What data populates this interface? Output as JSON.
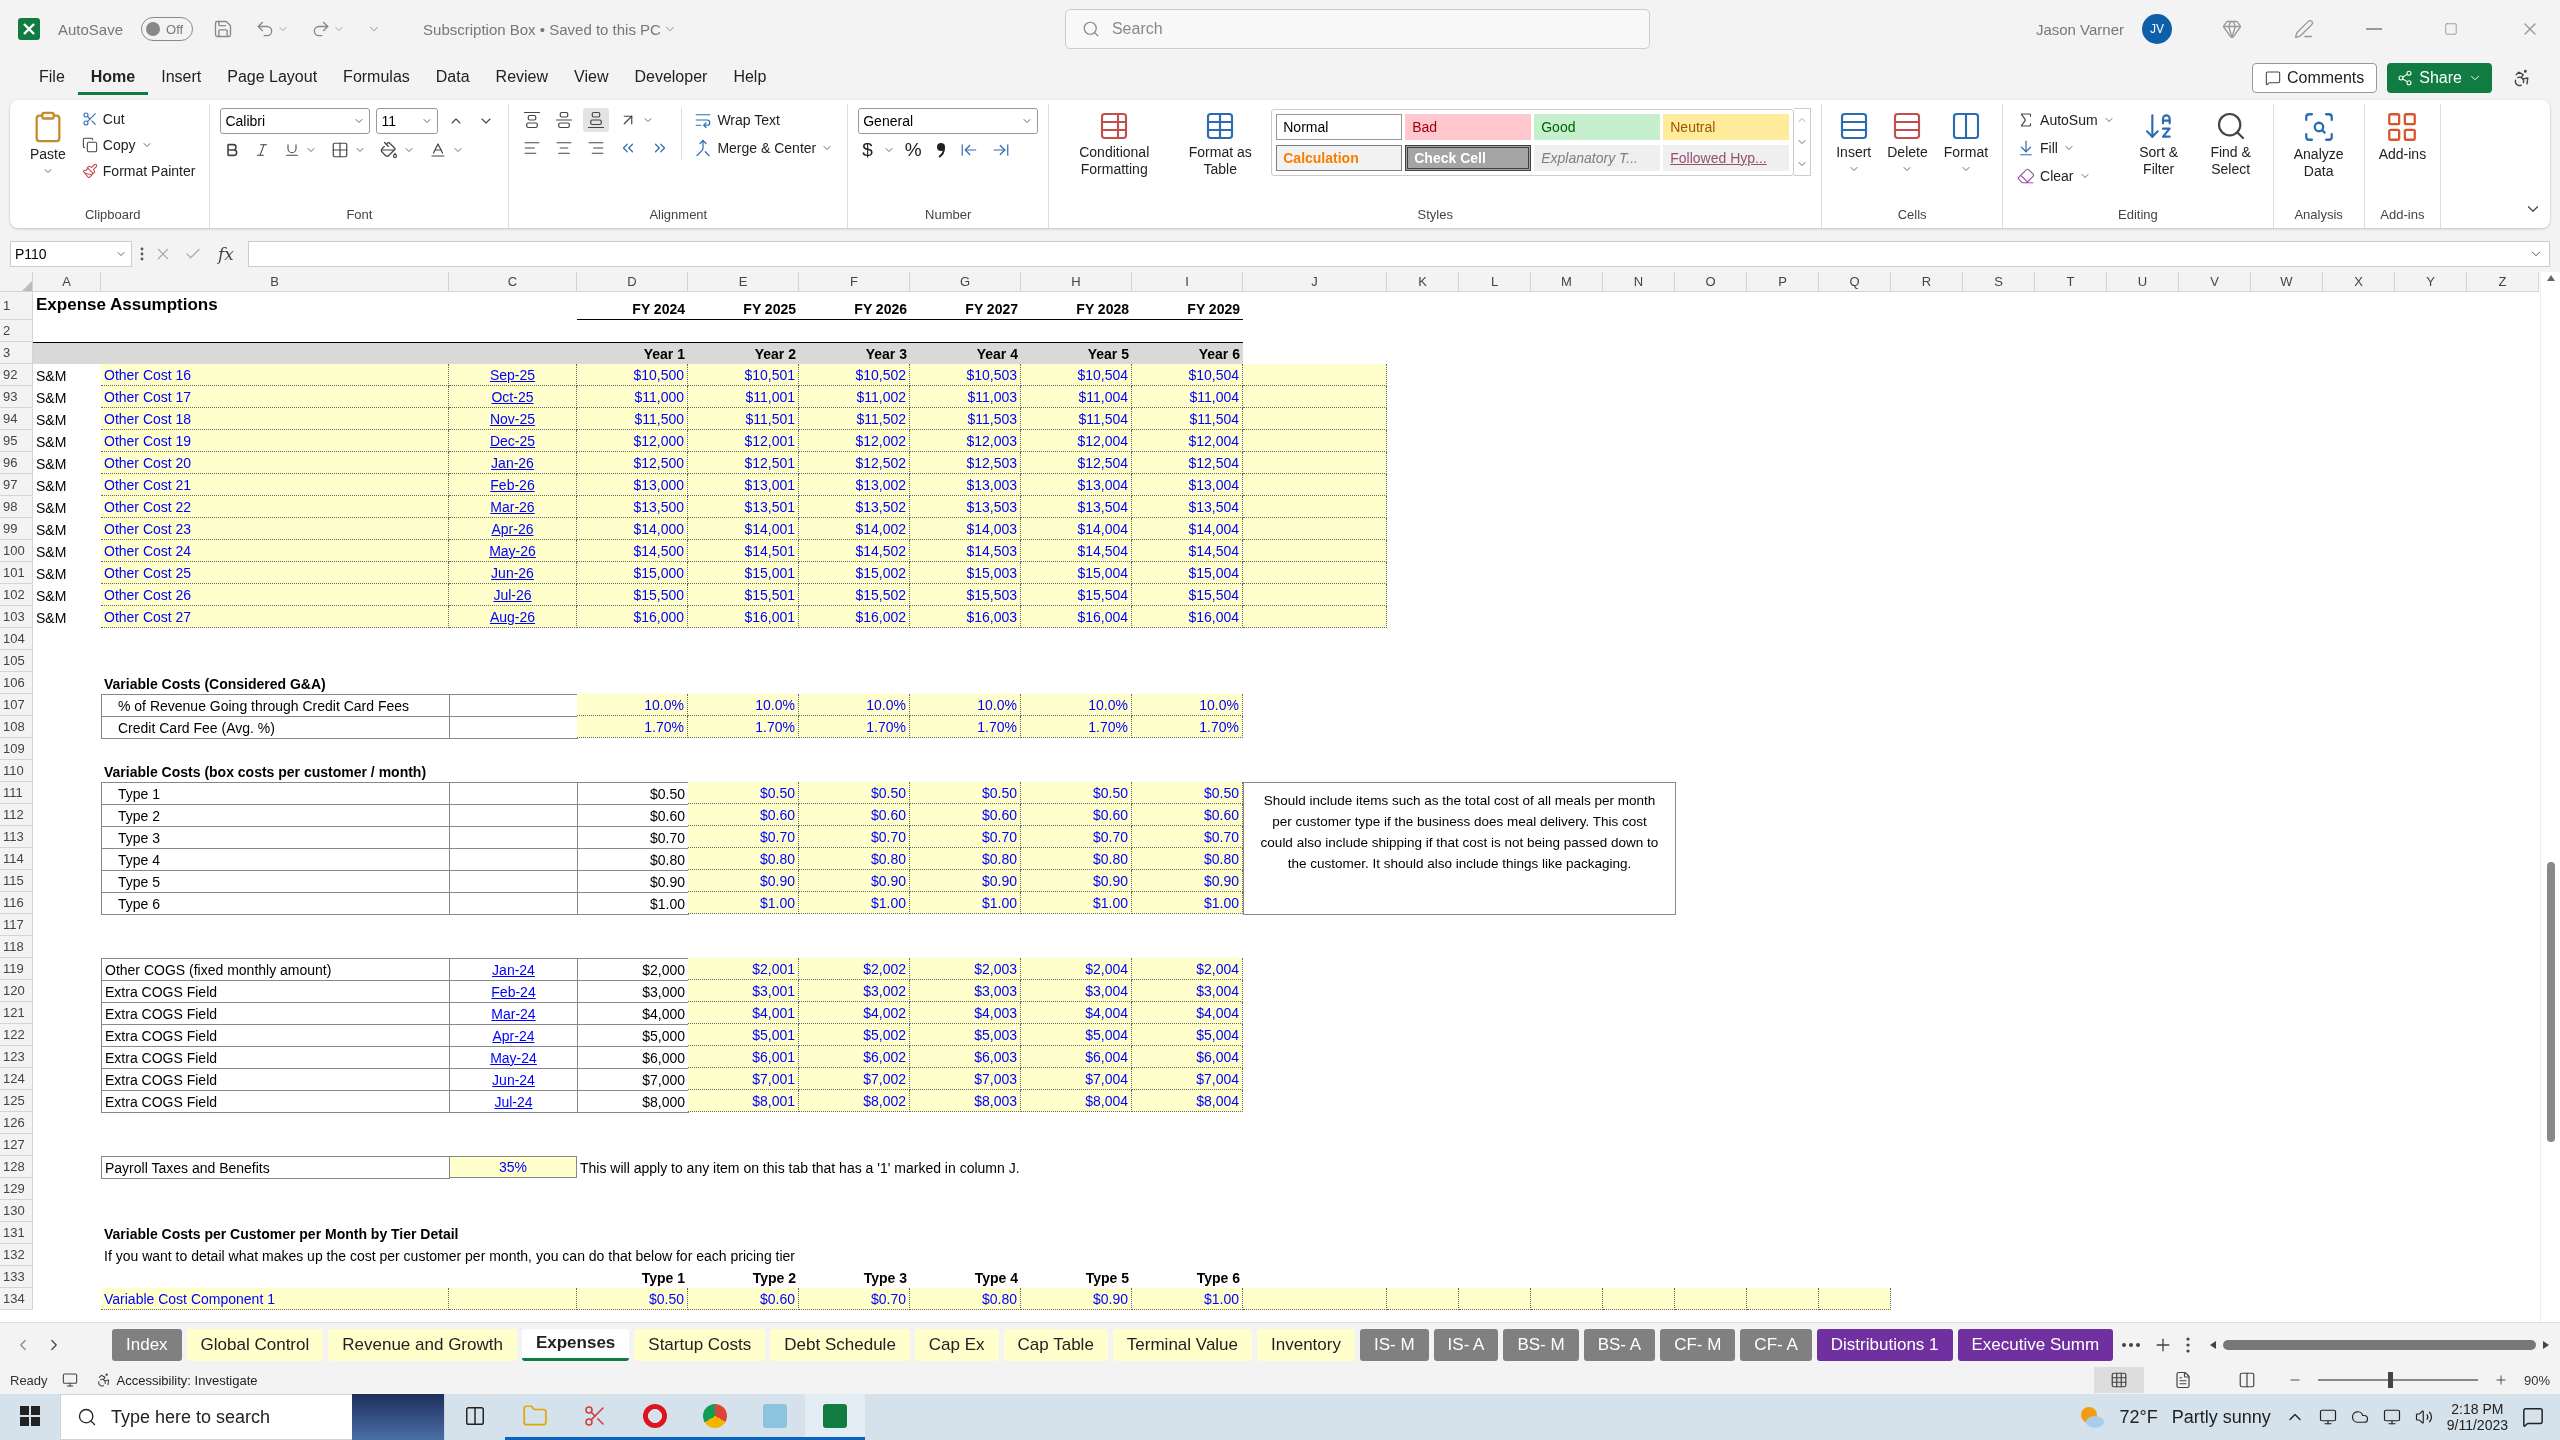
{
  "title_bar": {
    "autosave_label": "AutoSave",
    "autosave": {
      "on": false,
      "label": "Off"
    },
    "document": "Subscription Box • Saved to this PC",
    "search_placeholder": "Search",
    "user": "Jason Varner",
    "avatar": "JV"
  },
  "menu": {
    "tabs": [
      {
        "label": "File",
        "selected": false
      },
      {
        "label": "Home",
        "selected": true
      },
      {
        "label": "Insert",
        "selected": false
      },
      {
        "label": "Page Layout",
        "selected": false
      },
      {
        "label": "Formulas",
        "selected": false
      },
      {
        "label": "Data",
        "selected": false
      },
      {
        "label": "Review",
        "selected": false
      },
      {
        "label": "View",
        "selected": false
      },
      {
        "label": "Developer",
        "selected": false
      },
      {
        "label": "Help",
        "selected": false
      }
    ],
    "comments": "Comments",
    "share": "Share"
  },
  "ribbon": {
    "clipboard": {
      "label": "Clipboard",
      "paste": "Paste",
      "cut": "Cut",
      "copy": "Copy",
      "format_painter": "Format Painter"
    },
    "font": {
      "label": "Font",
      "name": "Calibri",
      "size": "11"
    },
    "alignment": {
      "label": "Alignment",
      "wrap": "Wrap Text",
      "merge": "Merge & Center"
    },
    "number": {
      "label": "Number",
      "format": "General",
      "currency": "$",
      "percent": "%"
    },
    "styles": {
      "label": "Styles",
      "conditional": "Conditional Formatting",
      "format_table": "Format as Table",
      "items": [
        {
          "label": "Normal",
          "kind": "normal"
        },
        {
          "label": "Bad",
          "kind": "bad"
        },
        {
          "label": "Good",
          "kind": "good"
        },
        {
          "label": "Neutral",
          "kind": "neutral"
        },
        {
          "label": "Calculation",
          "kind": "calculation"
        },
        {
          "label": "Check Cell",
          "kind": "check"
        },
        {
          "label": "Explanatory T...",
          "kind": "explanatory"
        },
        {
          "label": "Followed Hyp...",
          "kind": "followed"
        }
      ]
    },
    "cells": {
      "label": "Cells",
      "insert": "Insert",
      "delete": "Delete",
      "format": "Format"
    },
    "editing": {
      "label": "Editing",
      "autosum": "AutoSum",
      "fill": "Fill",
      "clear": "Clear",
      "sort": "Sort & Filter",
      "find": "Find & Select"
    },
    "analysis": {
      "label": "Analysis",
      "analyze": "Analyze Data"
    },
    "addins": {
      "label": "Add-ins",
      "addins": "Add-ins"
    }
  },
  "formula_bar": {
    "name_box": "P110",
    "fx": "fx"
  },
  "sheet": {
    "columns": [
      "A",
      "B",
      "C",
      "D",
      "E",
      "F",
      "G",
      "H",
      "I",
      "J",
      "K",
      "L",
      "M",
      "N",
      "O",
      "P",
      "Q",
      "R",
      "S",
      "T",
      "U",
      "V",
      "W",
      "X",
      "Y",
      "Z"
    ],
    "rows": [
      {
        "number": "1",
        "cells": [
          {
            "text": "Expense Assumptions",
            "kind": "title"
          },
          {
            "kind": "blank"
          },
          {
            "kind": "blank"
          },
          {
            "text": "FY 2024",
            "kind": "fy"
          },
          {
            "text": "FY 2025",
            "kind": "fy"
          },
          {
            "text": "FY 2026",
            "kind": "fy"
          },
          {
            "text": "FY 2027",
            "kind": "fy"
          },
          {
            "text": "FY 2028",
            "kind": "fy"
          },
          {
            "text": "FY 2029",
            "kind": "fy"
          }
        ]
      },
      {
        "number": "2",
        "cells": []
      },
      {
        "number": "3",
        "cells": [
          {
            "kind": "band"
          },
          {
            "kind": "band"
          },
          {
            "kind": "band"
          },
          {
            "text": "Year 1",
            "kind": "band"
          },
          {
            "text": "Year 2",
            "kind": "band"
          },
          {
            "text": "Year 3",
            "kind": "band"
          },
          {
            "text": "Year 4",
            "kind": "band"
          },
          {
            "text": "Year 5",
            "kind": "band"
          },
          {
            "text": "Year 6",
            "kind": "band"
          }
        ]
      },
      {
        "number": "92",
        "cells": [
          {
            "text": "S&M",
            "kind": "text"
          },
          {
            "text": "Other Cost 16",
            "kind": "input-label"
          },
          {
            "text": "Sep-25",
            "kind": "input-link"
          },
          {
            "text": "$10,500",
            "kind": "input"
          },
          {
            "text": "$10,501",
            "kind": "input"
          },
          {
            "text": "$10,502",
            "kind": "input"
          },
          {
            "text": "$10,503",
            "kind": "input"
          },
          {
            "text": "$10,504",
            "kind": "input"
          },
          {
            "text": "$10,504",
            "kind": "input"
          },
          {
            "kind": "input"
          }
        ]
      },
      {
        "number": "93",
        "cells": [
          {
            "text": "S&M",
            "kind": "text"
          },
          {
            "text": "Other Cost 17",
            "kind": "input-label"
          },
          {
            "text": "Oct-25",
            "kind": "input-link"
          },
          {
            "text": "$11,000",
            "kind": "input"
          },
          {
            "text": "$11,001",
            "kind": "input"
          },
          {
            "text": "$11,002",
            "kind": "input"
          },
          {
            "text": "$11,003",
            "kind": "input"
          },
          {
            "text": "$11,004",
            "kind": "input"
          },
          {
            "text": "$11,004",
            "kind": "input"
          },
          {
            "kind": "input"
          }
        ]
      },
      {
        "number": "94",
        "cells": [
          {
            "text": "S&M",
            "kind": "text"
          },
          {
            "text": "Other Cost 18",
            "kind": "input-label"
          },
          {
            "text": "Nov-25",
            "kind": "input-link"
          },
          {
            "text": "$11,500",
            "kind": "input"
          },
          {
            "text": "$11,501",
            "kind": "input"
          },
          {
            "text": "$11,502",
            "kind": "input"
          },
          {
            "text": "$11,503",
            "kind": "input"
          },
          {
            "text": "$11,504",
            "kind": "input"
          },
          {
            "text": "$11,504",
            "kind": "input"
          },
          {
            "kind": "input"
          }
        ]
      },
      {
        "number": "95",
        "cells": [
          {
            "text": "S&M",
            "kind": "text"
          },
          {
            "text": "Other Cost 19",
            "kind": "input-label"
          },
          {
            "text": "Dec-25",
            "kind": "input-link"
          },
          {
            "text": "$12,000",
            "kind": "input"
          },
          {
            "text": "$12,001",
            "kind": "input"
          },
          {
            "text": "$12,002",
            "kind": "input"
          },
          {
            "text": "$12,003",
            "kind": "input"
          },
          {
            "text": "$12,004",
            "kind": "input"
          },
          {
            "text": "$12,004",
            "kind": "input"
          },
          {
            "kind": "input"
          }
        ]
      },
      {
        "number": "96",
        "cells": [
          {
            "text": "S&M",
            "kind": "text"
          },
          {
            "text": "Other Cost 20",
            "kind": "input-label"
          },
          {
            "text": "Jan-26",
            "kind": "input-link"
          },
          {
            "text": "$12,500",
            "kind": "input"
          },
          {
            "text": "$12,501",
            "kind": "input"
          },
          {
            "text": "$12,502",
            "kind": "input"
          },
          {
            "text": "$12,503",
            "kind": "input"
          },
          {
            "text": "$12,504",
            "kind": "input"
          },
          {
            "text": "$12,504",
            "kind": "input"
          },
          {
            "kind": "input"
          }
        ]
      },
      {
        "number": "97",
        "cells": [
          {
            "text": "S&M",
            "kind": "text"
          },
          {
            "text": "Other Cost 21",
            "kind": "input-label"
          },
          {
            "text": "Feb-26",
            "kind": "input-link"
          },
          {
            "text": "$13,000",
            "kind": "input"
          },
          {
            "text": "$13,001",
            "kind": "input"
          },
          {
            "text": "$13,002",
            "kind": "input"
          },
          {
            "text": "$13,003",
            "kind": "input"
          },
          {
            "text": "$13,004",
            "kind": "input"
          },
          {
            "text": "$13,004",
            "kind": "input"
          },
          {
            "kind": "input"
          }
        ]
      },
      {
        "number": "98",
        "cells": [
          {
            "text": "S&M",
            "kind": "text"
          },
          {
            "text": "Other Cost 22",
            "kind": "input-label"
          },
          {
            "text": "Mar-26",
            "kind": "input-link"
          },
          {
            "text": "$13,500",
            "kind": "input"
          },
          {
            "text": "$13,501",
            "kind": "input"
          },
          {
            "text": "$13,502",
            "kind": "input"
          },
          {
            "text": "$13,503",
            "kind": "input"
          },
          {
            "text": "$13,504",
            "kind": "input"
          },
          {
            "text": "$13,504",
            "kind": "input"
          },
          {
            "kind": "input"
          }
        ]
      },
      {
        "number": "99",
        "cells": [
          {
            "text": "S&M",
            "kind": "text"
          },
          {
            "text": "Other Cost 23",
            "kind": "input-label"
          },
          {
            "text": "Apr-26",
            "kind": "input-link"
          },
          {
            "text": "$14,000",
            "kind": "input"
          },
          {
            "text": "$14,001",
            "kind": "input"
          },
          {
            "text": "$14,002",
            "kind": "input"
          },
          {
            "text": "$14,003",
            "kind": "input"
          },
          {
            "text": "$14,004",
            "kind": "input"
          },
          {
            "text": "$14,004",
            "kind": "input"
          },
          {
            "kind": "input"
          }
        ]
      },
      {
        "number": "100",
        "cells": [
          {
            "text": "S&M",
            "kind": "text"
          },
          {
            "text": "Other Cost 24",
            "kind": "input-label"
          },
          {
            "text": "May-26",
            "kind": "input-link"
          },
          {
            "text": "$14,500",
            "kind": "input"
          },
          {
            "text": "$14,501",
            "kind": "input"
          },
          {
            "text": "$14,502",
            "kind": "input"
          },
          {
            "text": "$14,503",
            "kind": "input"
          },
          {
            "text": "$14,504",
            "kind": "input"
          },
          {
            "text": "$14,504",
            "kind": "input"
          },
          {
            "kind": "input"
          }
        ]
      },
      {
        "number": "101",
        "cells": [
          {
            "text": "S&M",
            "kind": "text"
          },
          {
            "text": "Other Cost 25",
            "kind": "input-label"
          },
          {
            "text": "Jun-26",
            "kind": "input-link"
          },
          {
            "text": "$15,000",
            "kind": "input"
          },
          {
            "text": "$15,001",
            "kind": "input"
          },
          {
            "text": "$15,002",
            "kind": "input"
          },
          {
            "text": "$15,003",
            "kind": "input"
          },
          {
            "text": "$15,004",
            "kind": "input"
          },
          {
            "text": "$15,004",
            "kind": "input"
          },
          {
            "kind": "input"
          }
        ]
      },
      {
        "number": "102",
        "cells": [
          {
            "text": "S&M",
            "kind": "text"
          },
          {
            "text": "Other Cost 26",
            "kind": "input-label"
          },
          {
            "text": "Jul-26",
            "kind": "input-link"
          },
          {
            "text": "$15,500",
            "kind": "input"
          },
          {
            "text": "$15,501",
            "kind": "input"
          },
          {
            "text": "$15,502",
            "kind": "input"
          },
          {
            "text": "$15,503",
            "kind": "input"
          },
          {
            "text": "$15,504",
            "kind": "input"
          },
          {
            "text": "$15,504",
            "kind": "input"
          },
          {
            "kind": "input"
          }
        ]
      },
      {
        "number": "103",
        "cells": [
          {
            "text": "S&M",
            "kind": "text"
          },
          {
            "text": "Other Cost 27",
            "kind": "input-label"
          },
          {
            "text": "Aug-26",
            "kind": "input-link"
          },
          {
            "text": "$16,000",
            "kind": "input"
          },
          {
            "text": "$16,001",
            "kind": "input"
          },
          {
            "text": "$16,002",
            "kind": "input"
          },
          {
            "text": "$16,003",
            "kind": "input"
          },
          {
            "text": "$16,004",
            "kind": "input"
          },
          {
            "text": "$16,004",
            "kind": "input"
          },
          {
            "kind": "input"
          }
        ]
      },
      {
        "number": "104",
        "cells": []
      },
      {
        "number": "105",
        "cells": []
      },
      {
        "number": "106",
        "cells": [
          {
            "kind": "blank"
          },
          {
            "text": "Variable Costs (Considered G&A)",
            "kind": "heading"
          }
        ]
      },
      {
        "number": "107",
        "cells": [
          {
            "kind": "blank"
          },
          {
            "text": "% of Revenue Going through Credit Card Fees",
            "kind": "box-indent"
          },
          {
            "kind": "box"
          },
          {
            "text": "10.0%",
            "kind": "input"
          },
          {
            "text": "10.0%",
            "kind": "input"
          },
          {
            "text": "10.0%",
            "kind": "input"
          },
          {
            "text": "10.0%",
            "kind": "input"
          },
          {
            "text": "10.0%",
            "kind": "input"
          },
          {
            "text": "10.0%",
            "kind": "input"
          }
        ]
      },
      {
        "number": "108",
        "cells": [
          {
            "kind": "blank"
          },
          {
            "text": "Credit Card Fee (Avg. %)",
            "kind": "box-indent"
          },
          {
            "kind": "box"
          },
          {
            "text": "1.70%",
            "kind": "input"
          },
          {
            "text": "1.70%",
            "kind": "input"
          },
          {
            "text": "1.70%",
            "kind": "input"
          },
          {
            "text": "1.70%",
            "kind": "input"
          },
          {
            "text": "1.70%",
            "kind": "input"
          },
          {
            "text": "1.70%",
            "kind": "input"
          }
        ]
      },
      {
        "number": "109",
        "cells": []
      },
      {
        "number": "110",
        "cells": [
          {
            "kind": "blank"
          },
          {
            "text": "Variable Costs (box costs per customer / month)",
            "kind": "heading"
          }
        ]
      },
      {
        "number": "111",
        "cells": [
          {
            "kind": "blank"
          },
          {
            "text": "Type 1",
            "kind": "box-indent"
          },
          {
            "kind": "box"
          },
          {
            "text": "$0.50",
            "kind": "value"
          },
          {
            "text": "$0.50",
            "kind": "input"
          },
          {
            "text": "$0.50",
            "kind": "input"
          },
          {
            "text": "$0.50",
            "kind": "input"
          },
          {
            "text": "$0.50",
            "kind": "input"
          },
          {
            "text": "$0.50",
            "kind": "input"
          },
          {
            "text": "Should include items such as the total cost of all meals per month per customer type if the business does meal delivery. This cost could also include shipping if that cost is not being passed down to the customer. It should also include things like packaging.",
            "kind": "note"
          }
        ]
      },
      {
        "number": "112",
        "cells": [
          {
            "kind": "blank"
          },
          {
            "text": "Type 2",
            "kind": "box-indent"
          },
          {
            "kind": "box"
          },
          {
            "text": "$0.60",
            "kind": "value"
          },
          {
            "text": "$0.60",
            "kind": "input"
          },
          {
            "text": "$0.60",
            "kind": "input"
          },
          {
            "text": "$0.60",
            "kind": "input"
          },
          {
            "text": "$0.60",
            "kind": "input"
          },
          {
            "text": "$0.60",
            "kind": "input"
          }
        ]
      },
      {
        "number": "113",
        "cells": [
          {
            "kind": "blank"
          },
          {
            "text": "Type 3",
            "kind": "box-indent"
          },
          {
            "kind": "box"
          },
          {
            "text": "$0.70",
            "kind": "value"
          },
          {
            "text": "$0.70",
            "kind": "input"
          },
          {
            "text": "$0.70",
            "kind": "input"
          },
          {
            "text": "$0.70",
            "kind": "input"
          },
          {
            "text": "$0.70",
            "kind": "input"
          },
          {
            "text": "$0.70",
            "kind": "input"
          }
        ]
      },
      {
        "number": "114",
        "cells": [
          {
            "kind": "blank"
          },
          {
            "text": "Type 4",
            "kind": "box-indent"
          },
          {
            "kind": "box"
          },
          {
            "text": "$0.80",
            "kind": "value"
          },
          {
            "text": "$0.80",
            "kind": "input"
          },
          {
            "text": "$0.80",
            "kind": "input"
          },
          {
            "text": "$0.80",
            "kind": "input"
          },
          {
            "text": "$0.80",
            "kind": "input"
          },
          {
            "text": "$0.80",
            "kind": "input"
          }
        ]
      },
      {
        "number": "115",
        "cells": [
          {
            "kind": "blank"
          },
          {
            "text": "Type 5",
            "kind": "box-indent"
          },
          {
            "kind": "box"
          },
          {
            "text": "$0.90",
            "kind": "value"
          },
          {
            "text": "$0.90",
            "kind": "input"
          },
          {
            "text": "$0.90",
            "kind": "input"
          },
          {
            "text": "$0.90",
            "kind": "input"
          },
          {
            "text": "$0.90",
            "kind": "input"
          },
          {
            "text": "$0.90",
            "kind": "input"
          }
        ]
      },
      {
        "number": "116",
        "cells": [
          {
            "kind": "blank"
          },
          {
            "text": "Type 6",
            "kind": "box-indent"
          },
          {
            "kind": "box"
          },
          {
            "text": "$1.00",
            "kind": "value"
          },
          {
            "text": "$1.00",
            "kind": "input"
          },
          {
            "text": "$1.00",
            "kind": "input"
          },
          {
            "text": "$1.00",
            "kind": "input"
          },
          {
            "text": "$1.00",
            "kind": "input"
          },
          {
            "text": "$1.00",
            "kind": "input"
          }
        ]
      },
      {
        "number": "117",
        "cells": []
      },
      {
        "number": "118",
        "cells": []
      },
      {
        "number": "119",
        "cells": [
          {
            "kind": "blank"
          },
          {
            "text": "Other COGS (fixed monthly amount)",
            "kind": "box"
          },
          {
            "text": "Jan-24",
            "kind": "link"
          },
          {
            "text": "$2,000",
            "kind": "value"
          },
          {
            "text": "$2,001",
            "kind": "input"
          },
          {
            "text": "$2,002",
            "kind": "input"
          },
          {
            "text": "$2,003",
            "kind": "input"
          },
          {
            "text": "$2,004",
            "kind": "input"
          },
          {
            "text": "$2,004",
            "kind": "input"
          }
        ]
      },
      {
        "number": "120",
        "cells": [
          {
            "kind": "blank"
          },
          {
            "text": "Extra COGS Field",
            "kind": "box"
          },
          {
            "text": "Feb-24",
            "kind": "link"
          },
          {
            "text": "$3,000",
            "kind": "value"
          },
          {
            "text": "$3,001",
            "kind": "input"
          },
          {
            "text": "$3,002",
            "kind": "input"
          },
          {
            "text": "$3,003",
            "kind": "input"
          },
          {
            "text": "$3,004",
            "kind": "input"
          },
          {
            "text": "$3,004",
            "kind": "input"
          }
        ]
      },
      {
        "number": "121",
        "cells": [
          {
            "kind": "blank"
          },
          {
            "text": "Extra COGS Field",
            "kind": "box"
          },
          {
            "text": "Mar-24",
            "kind": "link"
          },
          {
            "text": "$4,000",
            "kind": "value"
          },
          {
            "text": "$4,001",
            "kind": "input"
          },
          {
            "text": "$4,002",
            "kind": "input"
          },
          {
            "text": "$4,003",
            "kind": "input"
          },
          {
            "text": "$4,004",
            "kind": "input"
          },
          {
            "text": "$4,004",
            "kind": "input"
          }
        ]
      },
      {
        "number": "122",
        "cells": [
          {
            "kind": "blank"
          },
          {
            "text": "Extra COGS Field",
            "kind": "box"
          },
          {
            "text": "Apr-24",
            "kind": "link"
          },
          {
            "text": "$5,000",
            "kind": "value"
          },
          {
            "text": "$5,001",
            "kind": "input"
          },
          {
            "text": "$5,002",
            "kind": "input"
          },
          {
            "text": "$5,003",
            "kind": "input"
          },
          {
            "text": "$5,004",
            "kind": "input"
          },
          {
            "text": "$5,004",
            "kind": "input"
          }
        ]
      },
      {
        "number": "123",
        "cells": [
          {
            "kind": "blank"
          },
          {
            "text": "Extra COGS Field",
            "kind": "box"
          },
          {
            "text": "May-24",
            "kind": "link"
          },
          {
            "text": "$6,000",
            "kind": "value"
          },
          {
            "text": "$6,001",
            "kind": "input"
          },
          {
            "text": "$6,002",
            "kind": "input"
          },
          {
            "text": "$6,003",
            "kind": "input"
          },
          {
            "text": "$6,004",
            "kind": "input"
          },
          {
            "text": "$6,004",
            "kind": "input"
          }
        ]
      },
      {
        "number": "124",
        "cells": [
          {
            "kind": "blank"
          },
          {
            "text": "Extra COGS Field",
            "kind": "box"
          },
          {
            "text": "Jun-24",
            "kind": "link"
          },
          {
            "text": "$7,000",
            "kind": "value"
          },
          {
            "text": "$7,001",
            "kind": "input"
          },
          {
            "text": "$7,002",
            "kind": "input"
          },
          {
            "text": "$7,003",
            "kind": "input"
          },
          {
            "text": "$7,004",
            "kind": "input"
          },
          {
            "text": "$7,004",
            "kind": "input"
          }
        ]
      },
      {
        "number": "125",
        "cells": [
          {
            "kind": "blank"
          },
          {
            "text": "Extra COGS Field",
            "kind": "box"
          },
          {
            "text": "Jul-24",
            "kind": "link"
          },
          {
            "text": "$8,000",
            "kind": "value"
          },
          {
            "text": "$8,001",
            "kind": "input"
          },
          {
            "text": "$8,002",
            "kind": "input"
          },
          {
            "text": "$8,003",
            "kind": "input"
          },
          {
            "text": "$8,004",
            "kind": "input"
          },
          {
            "text": "$8,004",
            "kind": "input"
          }
        ]
      },
      {
        "number": "126",
        "cells": []
      },
      {
        "number": "127",
        "cells": []
      },
      {
        "number": "128",
        "cells": [
          {
            "kind": "blank"
          },
          {
            "text": "Payroll Taxes and Benefits",
            "kind": "box"
          },
          {
            "text": "35%",
            "kind": "input-center"
          },
          {
            "text": "This will apply to any item on this tab that has a '1' marked in column J.",
            "kind": "text"
          }
        ]
      },
      {
        "number": "129",
        "cells": []
      },
      {
        "number": "130",
        "cells": []
      },
      {
        "number": "131",
        "cells": [
          {
            "kind": "blank"
          },
          {
            "text": "Variable Costs per Customer per Month by Tier Detail",
            "kind": "heading"
          }
        ]
      },
      {
        "number": "132",
        "cells": [
          {
            "kind": "blank"
          },
          {
            "text": "If you want to detail what makes up the cost per customer per month, you can do that  below for each pricing tier",
            "kind": "text"
          }
        ]
      },
      {
        "number": "133",
        "cells": [
          {
            "kind": "blank"
          },
          {
            "kind": "blank"
          },
          {
            "kind": "blank"
          },
          {
            "text": "Type 1",
            "kind": "bold-right"
          },
          {
            "text": "Type 2",
            "kind": "bold-right"
          },
          {
            "text": "Type 3",
            "kind": "bold-right"
          },
          {
            "text": "Type 4",
            "kind": "bold-right"
          },
          {
            "text": "Type 5",
            "kind": "bold-right"
          },
          {
            "text": "Type 6",
            "kind": "bold-right"
          }
        ]
      },
      {
        "number": "134",
        "cells": [
          {
            "kind": "blank"
          },
          {
            "text": "Variable Cost Component 1",
            "kind": "input-label"
          },
          {
            "kind": "input"
          },
          {
            "text": "$0.50",
            "kind": "input"
          },
          {
            "text": "$0.60",
            "kind": "input"
          },
          {
            "text": "$0.70",
            "kind": "input"
          },
          {
            "text": "$0.80",
            "kind": "input"
          },
          {
            "text": "$0.90",
            "kind": "input"
          },
          {
            "text": "$1.00",
            "kind": "input"
          },
          {
            "kind": "input"
          },
          {
            "kind": "input"
          },
          {
            "kind": "input"
          },
          {
            "kind": "input"
          },
          {
            "kind": "input"
          },
          {
            "kind": "input"
          },
          {
            "kind": "input"
          },
          {
            "kind": "input"
          }
        ]
      }
    ]
  },
  "sheet_tabs": [
    {
      "label": "Index",
      "color": "#808080",
      "selected": false
    },
    {
      "label": "Global Control",
      "color": "#ffffcc",
      "selected": false
    },
    {
      "label": "Revenue and Growth",
      "color": "#ffffcc",
      "selected": false
    },
    {
      "label": "Expenses",
      "selected": true
    },
    {
      "label": "Startup Costs",
      "color": "#ffffcc",
      "selected": false
    },
    {
      "label": "Debt Schedule",
      "color": "#ffffcc",
      "selected": false
    },
    {
      "label": "Cap Ex",
      "color": "#ffffcc",
      "selected": false
    },
    {
      "label": "Cap Table",
      "color": "#ffffcc",
      "selected": false
    },
    {
      "label": "Terminal Value",
      "color": "#ffffcc",
      "selected": false
    },
    {
      "label": "Inventory",
      "color": "#ffffcc",
      "selected": false
    },
    {
      "label": "IS- M",
      "color": "#808080",
      "selected": false
    },
    {
      "label": "IS- A",
      "color": "#808080",
      "selected": false
    },
    {
      "label": "BS- M",
      "color": "#808080",
      "selected": false
    },
    {
      "label": "BS- A",
      "color": "#808080",
      "selected": false
    },
    {
      "label": "CF- M",
      "color": "#808080",
      "selected": false
    },
    {
      "label": "CF- A",
      "color": "#808080",
      "selected": false
    },
    {
      "label": "Distributions 1",
      "color": "#7030a0",
      "selected": false
    },
    {
      "label": "Executive Summ",
      "color": "#7030a0",
      "selected": false
    }
  ],
  "status_bar": {
    "ready": "Ready",
    "accessibility": "Accessibility: Investigate",
    "zoom": "90%",
    "level": 0.45
  },
  "taskbar": {
    "search_placeholder": "Type here to search",
    "temperature": "72°F",
    "weather": "Partly sunny",
    "time": "2:18 PM",
    "date": "9/11/2023"
  }
}
